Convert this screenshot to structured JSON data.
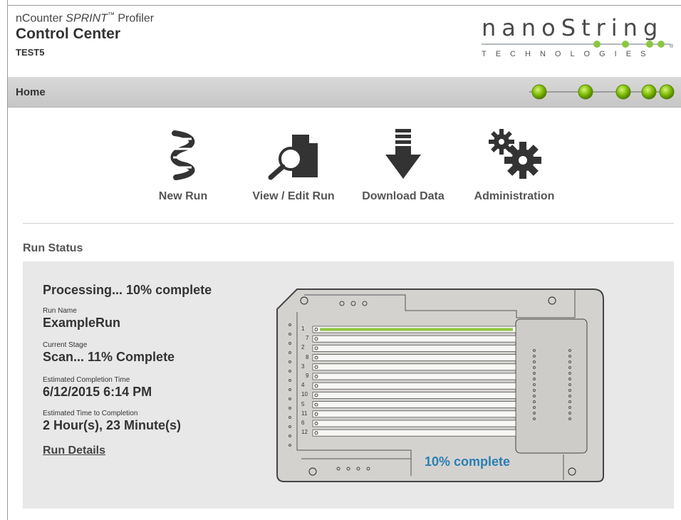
{
  "header": {
    "product_prefix": "nCounter ",
    "product_name": "SPRINT",
    "product_tm": "™",
    "product_suffix": " Profiler",
    "app_title": "Control Center",
    "instrument_name": "TEST5"
  },
  "logo": {
    "wordmark": "nanoString",
    "tagline": "TECHNOLOGIES",
    "registered": "®"
  },
  "navbar": {
    "title": "Home"
  },
  "tiles": [
    {
      "label": "New Run",
      "icon": "dna-helix-icon"
    },
    {
      "label": "View / Edit Run",
      "icon": "document-magnifier-icon"
    },
    {
      "label": "Download Data",
      "icon": "download-arrow-icon"
    },
    {
      "label": "Administration",
      "icon": "gears-icon"
    }
  ],
  "run_status": {
    "section_title": "Run Status",
    "headline": "Processing... 10% complete",
    "run_name_label": "Run Name",
    "run_name": "ExampleRun",
    "current_stage_label": "Current Stage",
    "current_stage": "Scan... 11% Complete",
    "est_completion_label": "Estimated Completion Time",
    "est_completion": "6/12/2015 6:14 PM",
    "time_to_completion_label": "Estimated Time to Completion",
    "time_to_completion": "2 Hour(s), 23 Minute(s)",
    "details_link": "Run Details"
  },
  "cartridge": {
    "progress_label": "10% complete",
    "progress_fraction": 0.1,
    "active_lane": "1",
    "lanes_left": [
      "1",
      "2",
      "3",
      "4",
      "5",
      "6"
    ],
    "lanes_right": [
      "7",
      "8",
      "9",
      "10",
      "11",
      "12"
    ]
  },
  "colors": {
    "accent_green": "#8cc63f",
    "progress_blue": "#2a7fb2",
    "nav_dot_green": "#7ab800"
  }
}
